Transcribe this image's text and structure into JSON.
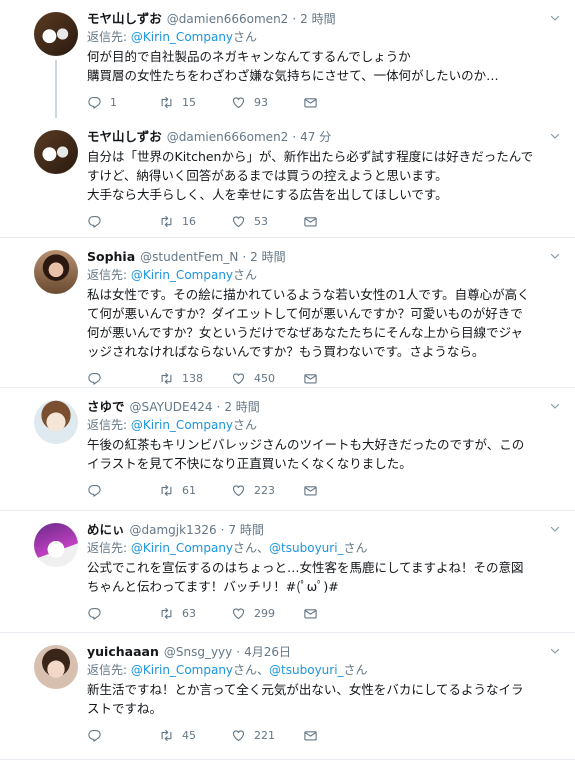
{
  "tweets": [
    {
      "name": "モヤ山しずお",
      "handle": "@damien666omen2",
      "time": "2 時間",
      "reply_prefix": "返信先: ",
      "reply_to": "@Kirin_Company",
      "reply_suffix": "さん",
      "text": "何が目的で自社製品のネガキャンなんてするんでしょうか\n購買層の女性たちをわざわざ嫌な気持ちにさせて、一体何がしたいのか…",
      "replies": "1",
      "retweets": "15",
      "likes": "93"
    },
    {
      "name": "モヤ山しずお",
      "handle": "@damien666omen2",
      "time": "47 分",
      "text": "自分は「世界のKitchenから」が、新作出たら必ず試す程度には好きだったんで\nすけど、納得いく回答があるまでは買うの控えようと思います。\n大手なら大手らしく、人を幸せにする広告を出してほしいです。",
      "replies": "",
      "retweets": "16",
      "likes": "53"
    },
    {
      "name": "Sophia",
      "handle": "@studentFem_N",
      "time": "2 時間",
      "reply_prefix": "返信先: ",
      "reply_to": "@Kirin_Company",
      "reply_suffix": "さん",
      "text": "私は女性です。その絵に描かれているような若い女性の1人です。自尊心が高く\nて何が悪いんですか？ダイエットして何が悪いんですか？可愛いものが好きで\n何が悪いんですか？女というだけでなぜあなたたちにそんな上から目線でジャ\nッジされなければならないんですか？もう買わないです。さようなら。",
      "replies": "",
      "retweets": "138",
      "likes": "450"
    },
    {
      "name": "さゆで",
      "handle": "@SAYUDE424",
      "time": "2 時間",
      "reply_prefix": "返信先: ",
      "reply_to": "@Kirin_Company",
      "reply_suffix": "さん",
      "text": "午後の紅茶もキリンビバレッジさんのツイートも大好きだったのですが、この\nイラストを見て不快になり正直買いたくなくなりました。",
      "replies": "",
      "retweets": "61",
      "likes": "223"
    },
    {
      "name": "めにぃ",
      "handle": "@damgjk1326",
      "time": "7 時間",
      "reply_prefix": "返信先: ",
      "reply_to": "@Kirin_Company",
      "reply_mid": "さん、",
      "reply_to2": "@tsuboyuri_",
      "reply_suffix": "さん",
      "text": "公式でこれを宣伝するのはちょっと…女性客を馬鹿にしてますよね！その意図\nちゃんと伝わってます！バッチリ！#(ﾟωﾟ)#",
      "replies": "",
      "retweets": "63",
      "likes": "299"
    },
    {
      "name": "yuichaaan",
      "handle": "@Snsg_yyy",
      "time": "4月26日",
      "reply_prefix": "返信先: ",
      "reply_to": "@Kirin_Company",
      "reply_mid": "さん、",
      "reply_to2": "@tsuboyuri_",
      "reply_suffix": "さん",
      "text": "新生活ですね！とか言って全く元気が出ない、女性をバカにしてるようなイラ\nストですね。",
      "replies": "",
      "retweets": "45",
      "likes": "221"
    }
  ],
  "icons": {
    "reply": "reply-icon",
    "retweet": "retweet-icon",
    "like": "heart-icon",
    "dm": "envelope-icon",
    "more": "chevron-down-icon"
  },
  "colors": {
    "link": "#1b95e0",
    "muted": "#657786",
    "border": "#e6ecf0"
  }
}
